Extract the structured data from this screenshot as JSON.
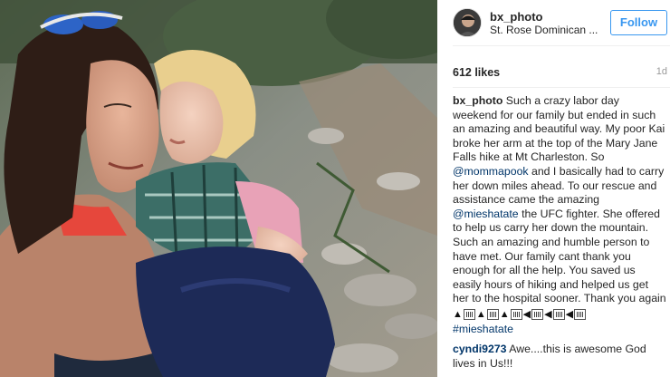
{
  "post": {
    "username": "bx_photo",
    "location": "St. Rose Dominican ...",
    "follow_label": "Follow",
    "likes": "612 likes",
    "time_ago": "1d",
    "caption": {
      "author": "bx_photo",
      "text_1": "Such a crazy labor day weekend for our family but ended in such an amazing and beautiful way. My poor Kai broke her arm at the top of the Mary Jane Falls hike at Mt Charleston. So",
      "mention_1": "@mommapook",
      "text_2": "and I basically had to carry her down miles ahead. To our rescue and assistance came the amazing",
      "mention_2": "@mieshatate",
      "text_3": "the UFC fighter. She offered to help us carry her down the mountain. Such an amazing and humble person to have met. Our family cant thank you enough for all the help. You saved us easily hours of hiking and helped us get her to the hospital sooner. Thank you again",
      "hashtag": "#mieshatate"
    },
    "comments": [
      {
        "author": "cyndi9273",
        "text": "Awe....this is awesome God lives in Us!!!"
      }
    ]
  },
  "colors": {
    "accent": "#3897f0",
    "link": "#003569",
    "text": "#262626",
    "muted": "#999999"
  }
}
